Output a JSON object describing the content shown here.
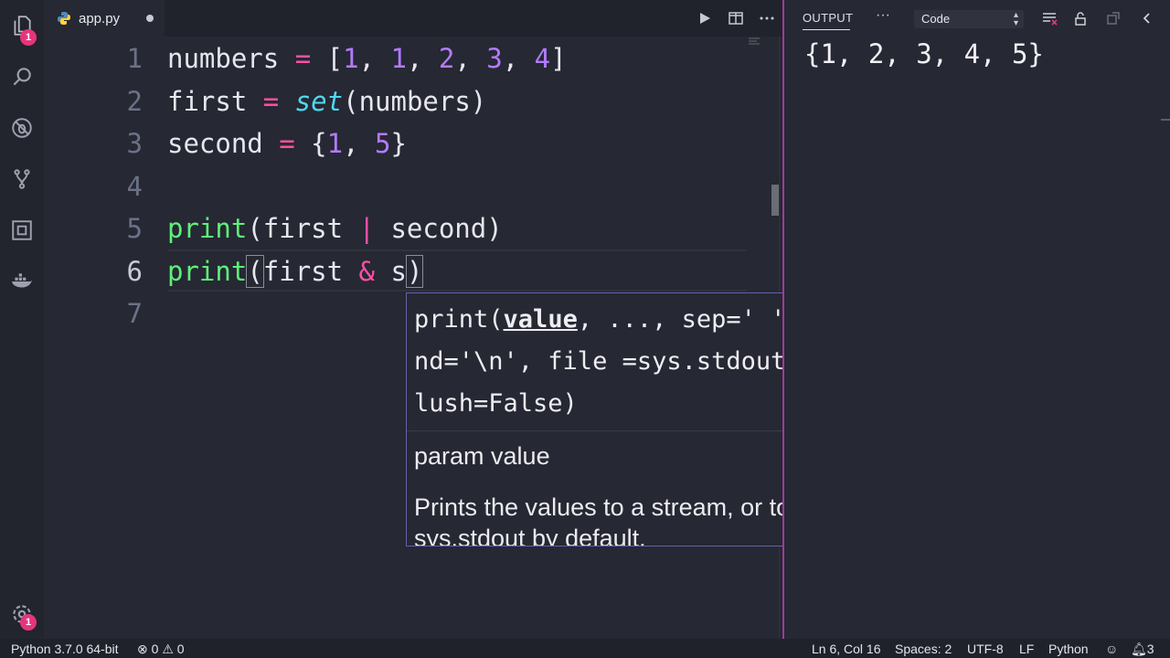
{
  "activity_bar": {
    "explorer_badge": "1",
    "settings_badge": "1"
  },
  "tab": {
    "filename": "app.py"
  },
  "editor": {
    "lines": [
      {
        "num": "1",
        "tokens": [
          {
            "t": "numbers",
            "c": "id"
          },
          {
            "t": " ",
            "c": "id"
          },
          {
            "t": "=",
            "c": "op"
          },
          {
            "t": " [",
            "c": "id"
          },
          {
            "t": "1",
            "c": "num"
          },
          {
            "t": ", ",
            "c": "id"
          },
          {
            "t": "1",
            "c": "num"
          },
          {
            "t": ", ",
            "c": "id"
          },
          {
            "t": "2",
            "c": "num"
          },
          {
            "t": ", ",
            "c": "id"
          },
          {
            "t": "3",
            "c": "num"
          },
          {
            "t": ", ",
            "c": "id"
          },
          {
            "t": "4",
            "c": "num"
          },
          {
            "t": "]",
            "c": "id"
          }
        ]
      },
      {
        "num": "2",
        "tokens": [
          {
            "t": "first",
            "c": "id"
          },
          {
            "t": " ",
            "c": "id"
          },
          {
            "t": "=",
            "c": "op"
          },
          {
            "t": " ",
            "c": "id"
          },
          {
            "t": "set",
            "c": "kw-type"
          },
          {
            "t": "(numbers)",
            "c": "id"
          }
        ]
      },
      {
        "num": "3",
        "tokens": [
          {
            "t": "second",
            "c": "id"
          },
          {
            "t": " ",
            "c": "id"
          },
          {
            "t": "=",
            "c": "op"
          },
          {
            "t": " {",
            "c": "id"
          },
          {
            "t": "1",
            "c": "num"
          },
          {
            "t": ", ",
            "c": "id"
          },
          {
            "t": "5",
            "c": "num"
          },
          {
            "t": "}",
            "c": "id"
          }
        ]
      },
      {
        "num": "4",
        "tokens": []
      },
      {
        "num": "5",
        "tokens": [
          {
            "t": "print",
            "c": "kw-fn"
          },
          {
            "t": "(first ",
            "c": "id"
          },
          {
            "t": "|",
            "c": "op"
          },
          {
            "t": " second)",
            "c": "id"
          }
        ]
      },
      {
        "num": "6",
        "tokens": [
          {
            "t": "print",
            "c": "kw-fn"
          },
          {
            "t": "(",
            "c": "id bracket-hl"
          },
          {
            "t": "first ",
            "c": "id"
          },
          {
            "t": "&",
            "c": "op"
          },
          {
            "t": " s",
            "c": "id"
          },
          {
            "t": ")",
            "c": "id bracket-hl"
          }
        ]
      },
      {
        "num": "7",
        "tokens": []
      }
    ],
    "active_line": "6"
  },
  "hover": {
    "sig_prefix": "print(",
    "sig_active_param": "value",
    "sig_rest": ", ..., sep=' ', end='\\n', file =sys.stdout, flush=False)",
    "param_label": "param value",
    "description": "Prints the values to a stream, or to sys.stdout by default."
  },
  "output_panel": {
    "title": "OUTPUT",
    "more": "···",
    "channel": "Code",
    "text": "{1, 2, 3, 4, 5}"
  },
  "status_bar": {
    "interpreter": "Python 3.7.0 64-bit",
    "errors": "0",
    "warnings": "0",
    "position": "Ln 6, Col 16",
    "spaces": "Spaces: 2",
    "encoding": "UTF-8",
    "eol": "LF",
    "language": "Python",
    "notifications": "3"
  },
  "colors": {
    "background": "#262833",
    "keyword_function": "#5ff07a",
    "builtin_type": "#4fd8f0",
    "operator": "#ff4fa6",
    "number": "#b37bff",
    "badge": "#e4357c",
    "panel_divider": "#a23a98"
  }
}
